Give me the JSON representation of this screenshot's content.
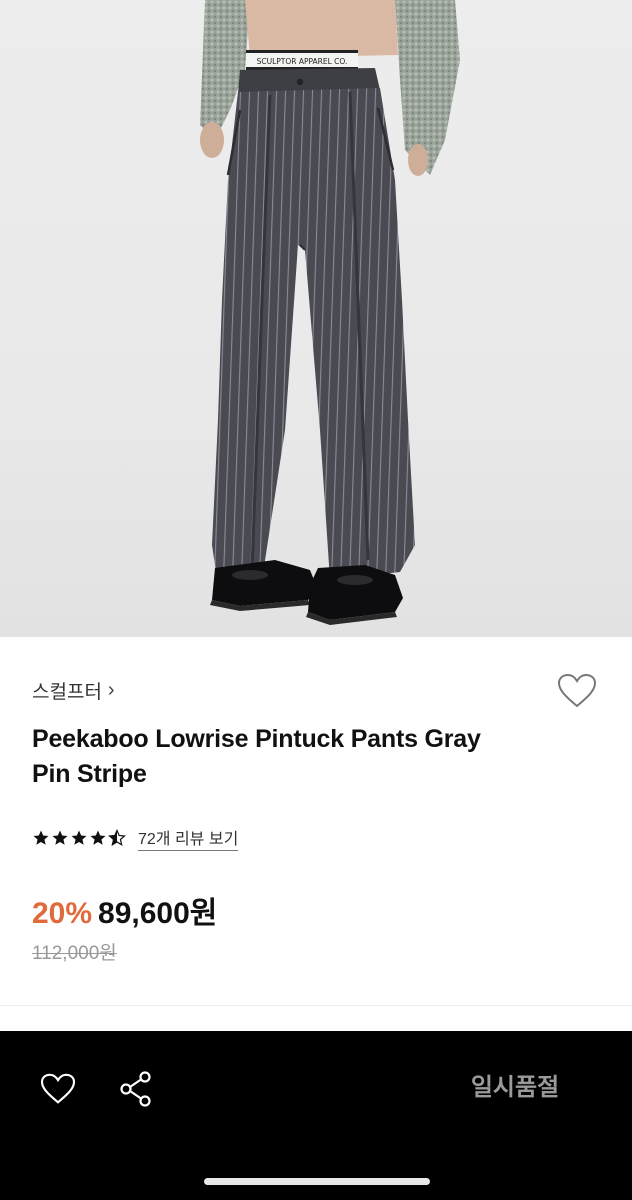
{
  "product_image": {
    "waistband_text": "SCULPTOR APPAREL CO."
  },
  "brand": {
    "name": "스컬프터",
    "chevron": "›"
  },
  "product": {
    "title_line1": "Peekaboo Lowrise Pintuck Pants Gray",
    "title_line2": "Pin Stripe"
  },
  "rating": {
    "stars": 4.5,
    "review_link": "72개 리뷰 보기"
  },
  "pricing": {
    "discount": "20%",
    "sale_price": "89,600원",
    "original_price": "112,000원"
  },
  "colors": {
    "discount": "#e06b3a",
    "bottom_bar": "#000000",
    "soldout_text": "#9a9a9a"
  },
  "bottom_bar": {
    "wishlist_icon": "heart-outline-icon",
    "share_icon": "share-icon",
    "soldout_label": "일시품절"
  }
}
